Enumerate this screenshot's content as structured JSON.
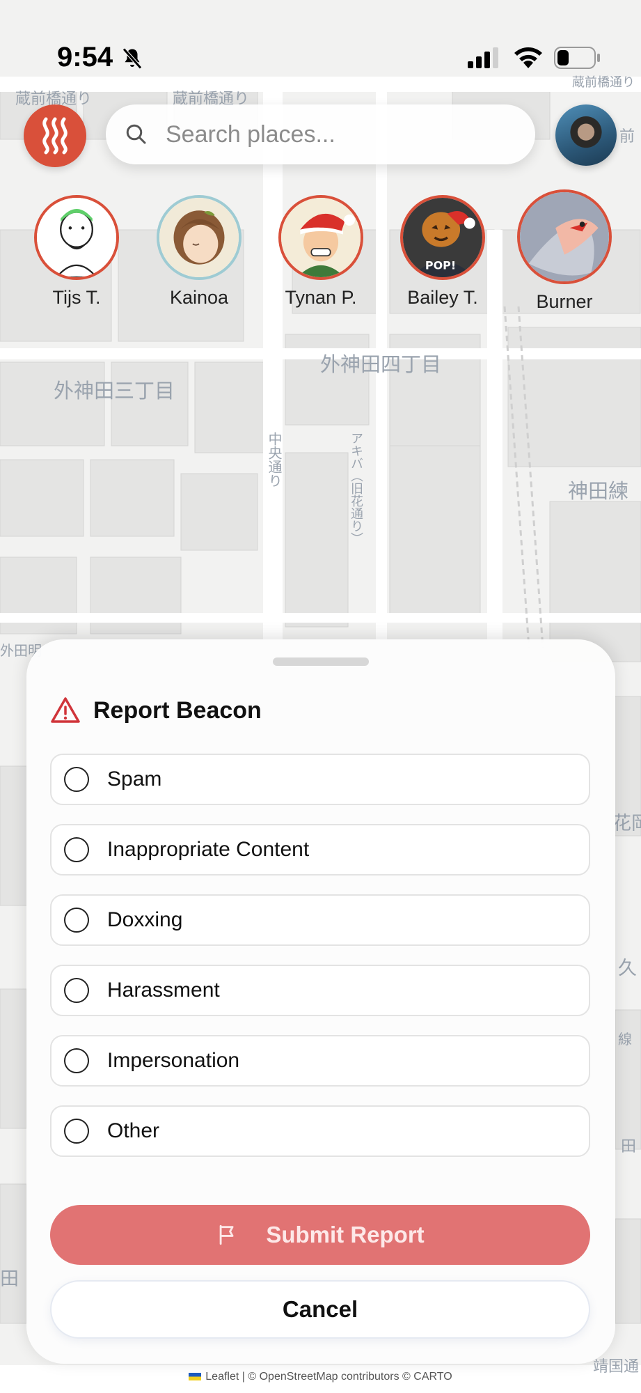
{
  "status_bar": {
    "time": "9:54"
  },
  "search": {
    "placeholder": "Search places..."
  },
  "friends": [
    {
      "name": "Tijs T."
    },
    {
      "name": "Kainoa"
    },
    {
      "name": "Tynan P."
    },
    {
      "name": "Bailey T."
    },
    {
      "name": "Burner"
    }
  ],
  "map": {
    "labels": [
      "蔵前橋通り",
      "蔵前橋通り",
      "蔵前橋通り",
      "前",
      "外神田四丁目",
      "外神田三丁目",
      "神田練",
      "中央通り",
      "アキバ（旧花通り）",
      "外田明",
      "花岡",
      "久",
      "線",
      "田",
      "靖国通",
      "田"
    ],
    "attribution": "Leaflet | © OpenStreetMap contributors © CARTO"
  },
  "report_sheet": {
    "title": "Report Beacon",
    "options": [
      "Spam",
      "Inappropriate Content",
      "Doxxing",
      "Harassment",
      "Impersonation",
      "Other"
    ],
    "submit_label": "Submit Report",
    "cancel_label": "Cancel"
  },
  "colors": {
    "brand": "#d9503a",
    "submit_disabled": "#e17373"
  },
  "icons": [
    "bell-slash-icon",
    "signal-icon",
    "wifi-icon",
    "battery-icon",
    "steam-logo-icon",
    "search-icon",
    "warning-icon",
    "flag-icon"
  ]
}
